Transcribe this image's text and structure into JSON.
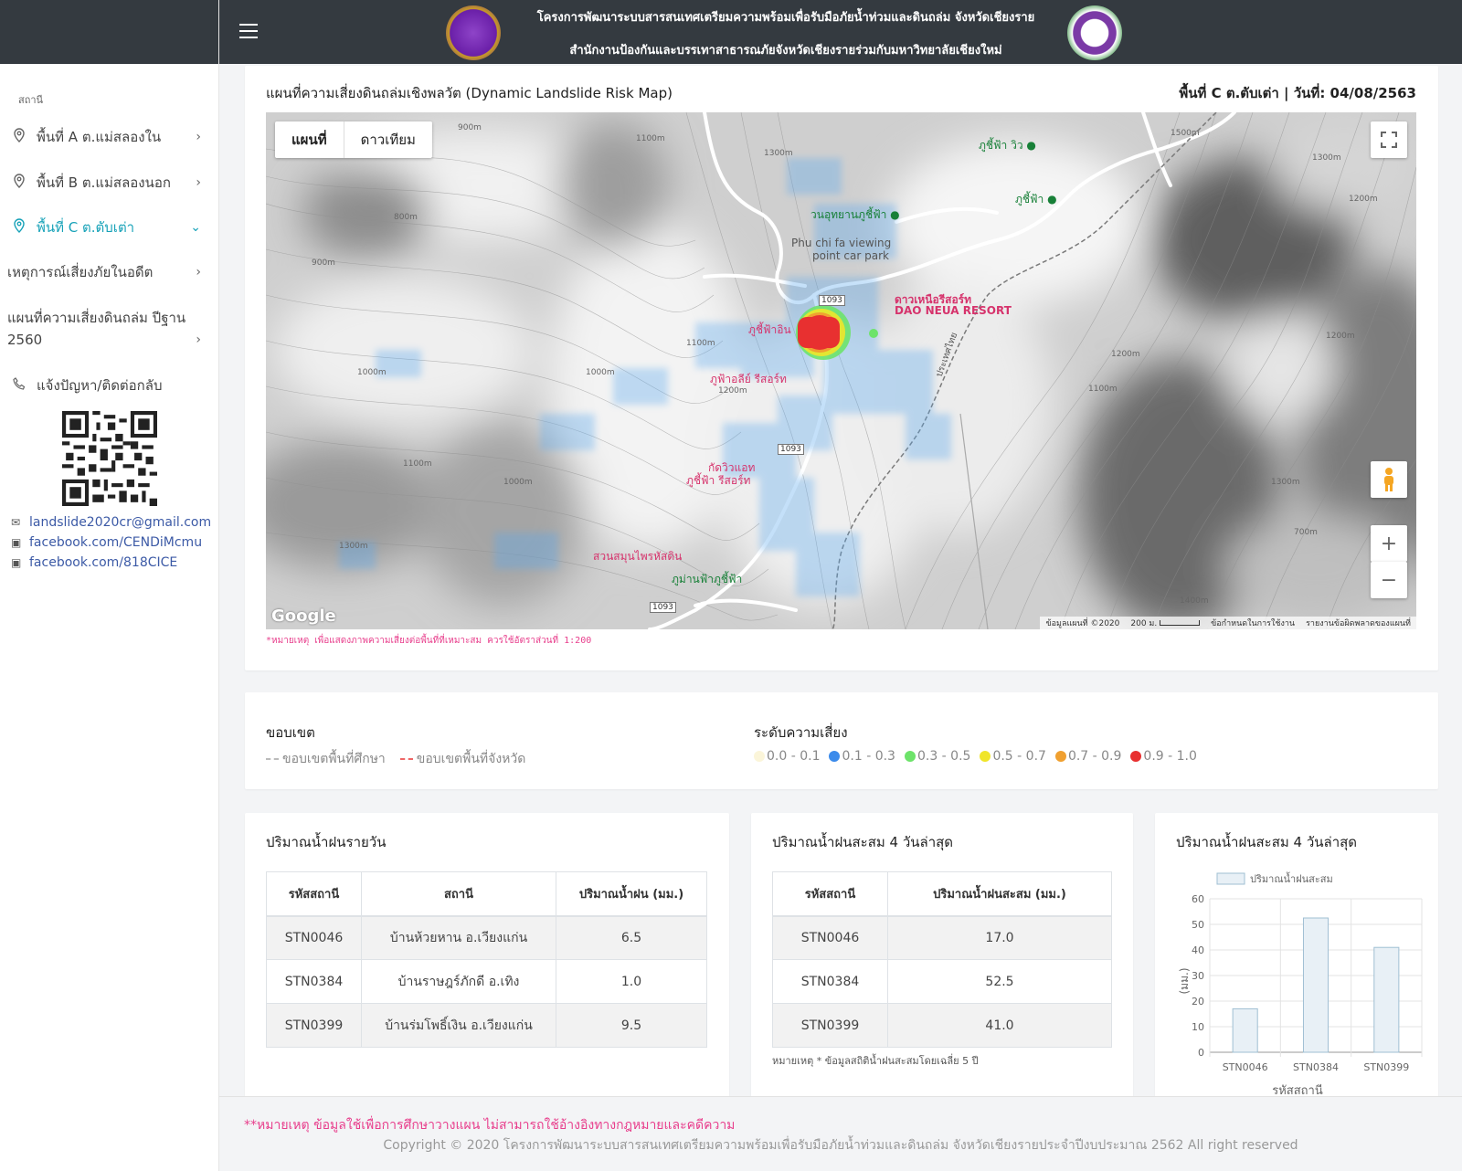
{
  "header": {
    "line1": "โครงการพัฒนาระบบสารสนเทศเตรียมความพร้อมเพื่อรับมือภัยน้ำท่วมและดินถล่ม จังหวัดเชียงราย",
    "line2": "สำนักงานป้องกันและบรรเทาสาธารณภัยจังหวัดเชียงรายร่วมกับมหาวิทยาลัยเชียงใหม่"
  },
  "sidebar": {
    "section_title": "สถานี",
    "items": [
      {
        "label": "พื้นที่ A ต.แม่สลองใน",
        "icon": "map-pin-icon"
      },
      {
        "label": "พื้นที่ B ต.แม่สลองนอก",
        "icon": "map-pin-icon"
      },
      {
        "label": "พื้นที่ C ต.ตับเต่า",
        "icon": "map-pin-icon"
      },
      {
        "label": "เหตุการณ์เสี่ยงภัยในอดีต"
      },
      {
        "label": "แผนที่ความเสี่ยงดินถล่ม ปีฐาน 2560"
      },
      {
        "label": "แจ้งปัญหา/ติดต่อกลับ",
        "icon": "phone-icon"
      }
    ],
    "contacts": [
      {
        "text": "landslide2020cr@gmail.com",
        "icon": "email-icon"
      },
      {
        "text": "facebook.com/CENDiMcmu",
        "icon": "facebook-icon"
      },
      {
        "text": "facebook.com/818CICE",
        "icon": "facebook-icon"
      }
    ]
  },
  "map_card": {
    "title": "แผนที่ความเสี่ยงดินถล่มเชิงพลวัต (Dynamic Landslide Risk Map)",
    "subtitle": "พื้นที่ C ต.ตับเต่า | วันที่: 04/08/2563",
    "type_buttons": [
      "แผนที่",
      "ดาวเทียม"
    ],
    "note": "*หมายเหตุ เพื่อแสดงภาพความเสี่ยงต่อพื้นที่ที่เหมาะสม ควรใช้อัตราส่วนที่ 1:200",
    "google": "Google",
    "attribution": [
      "ข้อมูลแผนที่ ©2020",
      "200 ม.",
      "ข้อกำหนดในการใช้งาน",
      "รายงานข้อผิดพลาดของแผนที่"
    ],
    "places": [
      {
        "name": "ภูชี้ฟ้า วิว",
        "color": "green"
      },
      {
        "name": "ภูชี้ฟ้า",
        "color": "green"
      },
      {
        "name": "วนอุทยานภูชี้ฟ้า",
        "color": "green"
      },
      {
        "name": "Phu chi fa viewing",
        "color": "gray"
      },
      {
        "name": "point car park",
        "color": "gray"
      },
      {
        "name": "ดาวเหนือรีสอร์ท",
        "color": "pink"
      },
      {
        "name": "DAO NEUA RESORT",
        "color": "pink"
      },
      {
        "name": "ภูชี้ฟ้าอิน",
        "color": "pink"
      },
      {
        "name": "ภูฟ้าอลีย์ รีสอร์ท",
        "color": "pink"
      },
      {
        "name": "กัดวิวแอท",
        "color": "pink"
      },
      {
        "name": "ภูชี้ฟ้า รีสอร์ท",
        "color": "pink"
      },
      {
        "name": "สวนสมุนไพรหัสดิน",
        "color": "pink"
      },
      {
        "name": "ภูม่านฟ้าภูชี้ฟ้า",
        "color": "green"
      },
      {
        "name": "ประเทศไทย",
        "color": "gray"
      }
    ],
    "road_labels": [
      "1093",
      "1093",
      "1093"
    ],
    "contours": [
      "1100m",
      "1100m",
      "1100m",
      "1200m",
      "1300m",
      "1300m",
      "1400m",
      "1500m",
      "1000m",
      "1000m",
      "900m",
      "900m",
      "800m",
      "700m",
      "1200m",
      "1300m",
      "1200m",
      "1300m",
      "1100m",
      "1200m",
      "1000m"
    ]
  },
  "legend": {
    "boundary_title": "ขอบเขต",
    "boundary_items": [
      "ขอบเขตพื้นที่ศึกษา",
      "ขอบเขตพื้นที่จังหวัด"
    ],
    "risk_title": "ระดับความเสี่ยง",
    "risk_items": [
      {
        "label": "0.0 - 0.1",
        "color": "#fbf5d9"
      },
      {
        "label": "0.1 - 0.3",
        "color": "#3b8beb"
      },
      {
        "label": "0.3 - 0.5",
        "color": "#6de36a"
      },
      {
        "label": "0.5 - 0.7",
        "color": "#f0e52a"
      },
      {
        "label": "0.7 - 0.9",
        "color": "#f0a030"
      },
      {
        "label": "0.9 - 1.0",
        "color": "#e83030"
      }
    ]
  },
  "daily_table": {
    "title": "ปริมาณน้ำฝนรายวัน",
    "headers": [
      "รหัสสถานี",
      "สถานี",
      "ปริมาณน้ำฝน (มม.)"
    ],
    "rows": [
      [
        "STN0046",
        "บ้านห้วยหาน อ.เวียงแก่น",
        "6.5"
      ],
      [
        "STN0384",
        "บ้านราษฎร์ภักดี อ.เทิง",
        "1.0"
      ],
      [
        "STN0399",
        "บ้านร่มโพธิ์เงิน อ.เวียงแก่น",
        "9.5"
      ]
    ]
  },
  "cum_table": {
    "title": "ปริมาณน้ำฝนสะสม 4 วันล่าสุด",
    "headers": [
      "รหัสสถานี",
      "ปริมาณน้ำฝนสะสม (มม.)"
    ],
    "rows": [
      [
        "STN0046",
        "17.0"
      ],
      [
        "STN0384",
        "52.5"
      ],
      [
        "STN0399",
        "41.0"
      ]
    ],
    "note": "หมายเหตุ * ข้อมูลสถิติน้ำฝนสะสมโดยเฉลี่ย 5 ปี"
  },
  "chart_card": {
    "title": "ปริมาณน้ำฝนสะสม 4 วันล่าสุด"
  },
  "chart_data": {
    "type": "bar",
    "categories": [
      "STN0046",
      "STN0384",
      "STN0399"
    ],
    "series": [
      {
        "name": "ปริมาณน้ำฝนสะสม",
        "values": [
          17.0,
          52.5,
          41.0
        ]
      }
    ],
    "xlabel": "รหัสสถานี",
    "ylabel": "(มม.)",
    "ylim": [
      0,
      60
    ],
    "yticks": [
      0,
      10,
      20,
      30,
      40,
      50,
      60
    ],
    "bar_color": "#e8f0f6",
    "bar_border": "#9fbfd3",
    "grid": true,
    "legend": "top"
  },
  "footer": {
    "note": "**หมายเหตุ ข้อมูลใช้เพื่อการศึกษาวางแผน ไม่สามารถใช้อ้างอิงทางกฎหมายและคดีความ",
    "copyright": "Copyright © 2020 โครงการพัฒนาระบบสารสนเทศเตรียมความพร้อมเพื่อรับมือภัยน้ำท่วมและดินถล่ม จังหวัดเชียงรายประจำปีงบประมาณ 2562 All right reserved"
  }
}
